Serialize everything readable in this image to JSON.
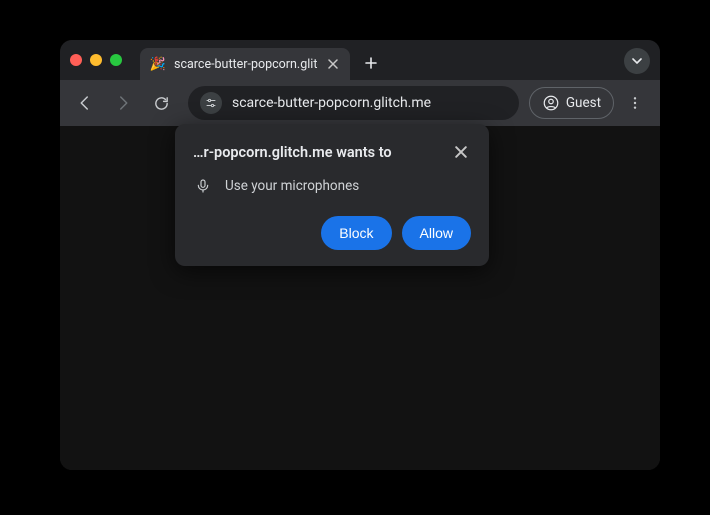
{
  "tab": {
    "favicon": "🎉",
    "title": "scarce-butter-popcorn.glitch"
  },
  "toolbar": {
    "url": "scarce-butter-popcorn.glitch.me",
    "profile_label": "Guest"
  },
  "permission": {
    "title": "…r-popcorn.glitch.me wants to",
    "item": "Use your microphones",
    "block_label": "Block",
    "allow_label": "Allow"
  }
}
